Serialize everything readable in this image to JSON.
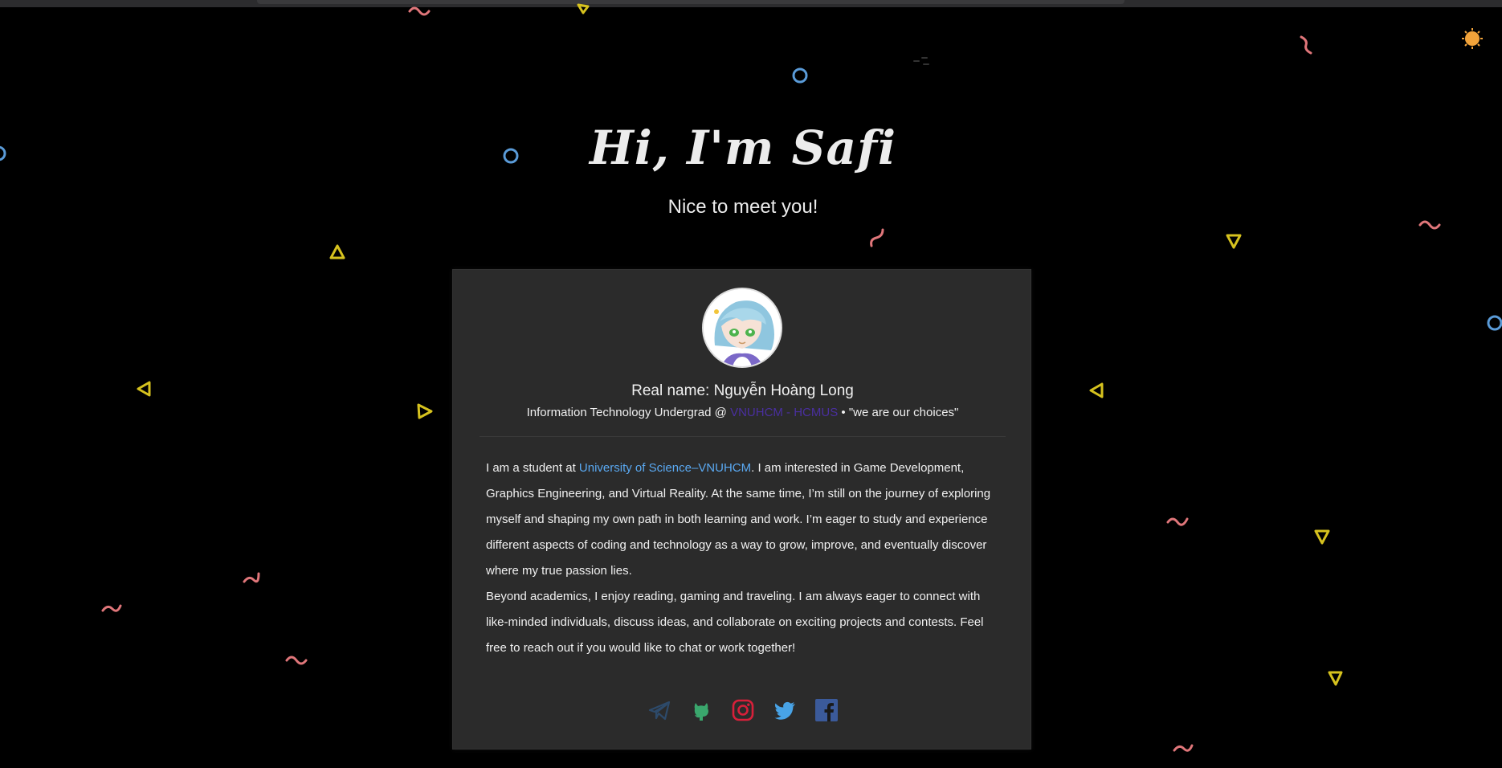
{
  "hero": {
    "title": "Hi, I'm Safi",
    "subtitle": "Nice to meet you!"
  },
  "profile": {
    "real_name": "Real name: Nguyễn Hoàng Long",
    "subline_prefix": "Information Technology Undergrad @ ",
    "university_short": "VNUHCM - HCMUS",
    "subline_suffix": " • \"we are our choices\"",
    "bio": {
      "p1_prefix": "I am a student at ",
      "p1_link": "University of Science–VNUHCM",
      "p1_rest": ". I am interested in Game Development, Graphics Engineering, and Virtual Reality. At the same time, I’m still on the journey of exploring myself and shaping my own path in both learning and work. I’m eager to study and experience different aspects of coding and technology as a way to grow, improve, and eventually discover where my true passion lies.",
      "p2": "Beyond academics, I enjoy reading, gaming and traveling. I am always eager to connect with like-minded individuals, discuss ideas, and collaborate on exciting projects and contests. Feel free to reach out if you would like to chat or work together!"
    }
  },
  "socials": [
    {
      "icon": "telegram-icon",
      "color": "#2d4a6a"
    },
    {
      "icon": "github-icon",
      "color": "#3aa76d"
    },
    {
      "icon": "instagram-icon",
      "color": "#d8203a"
    },
    {
      "icon": "twitter-icon",
      "color": "#48a3e6"
    },
    {
      "icon": "facebook-icon",
      "color": "#3b5a9a"
    }
  ],
  "colors": {
    "background": "#000000",
    "card": "#2b2b2b",
    "link": "#5aa9f2",
    "university": "#4a2fa0",
    "confetti_pink": "#e0767a",
    "confetti_yellow": "#d6c21e",
    "confetti_blue": "#5a9bd8",
    "sun": "#f2a33a"
  }
}
